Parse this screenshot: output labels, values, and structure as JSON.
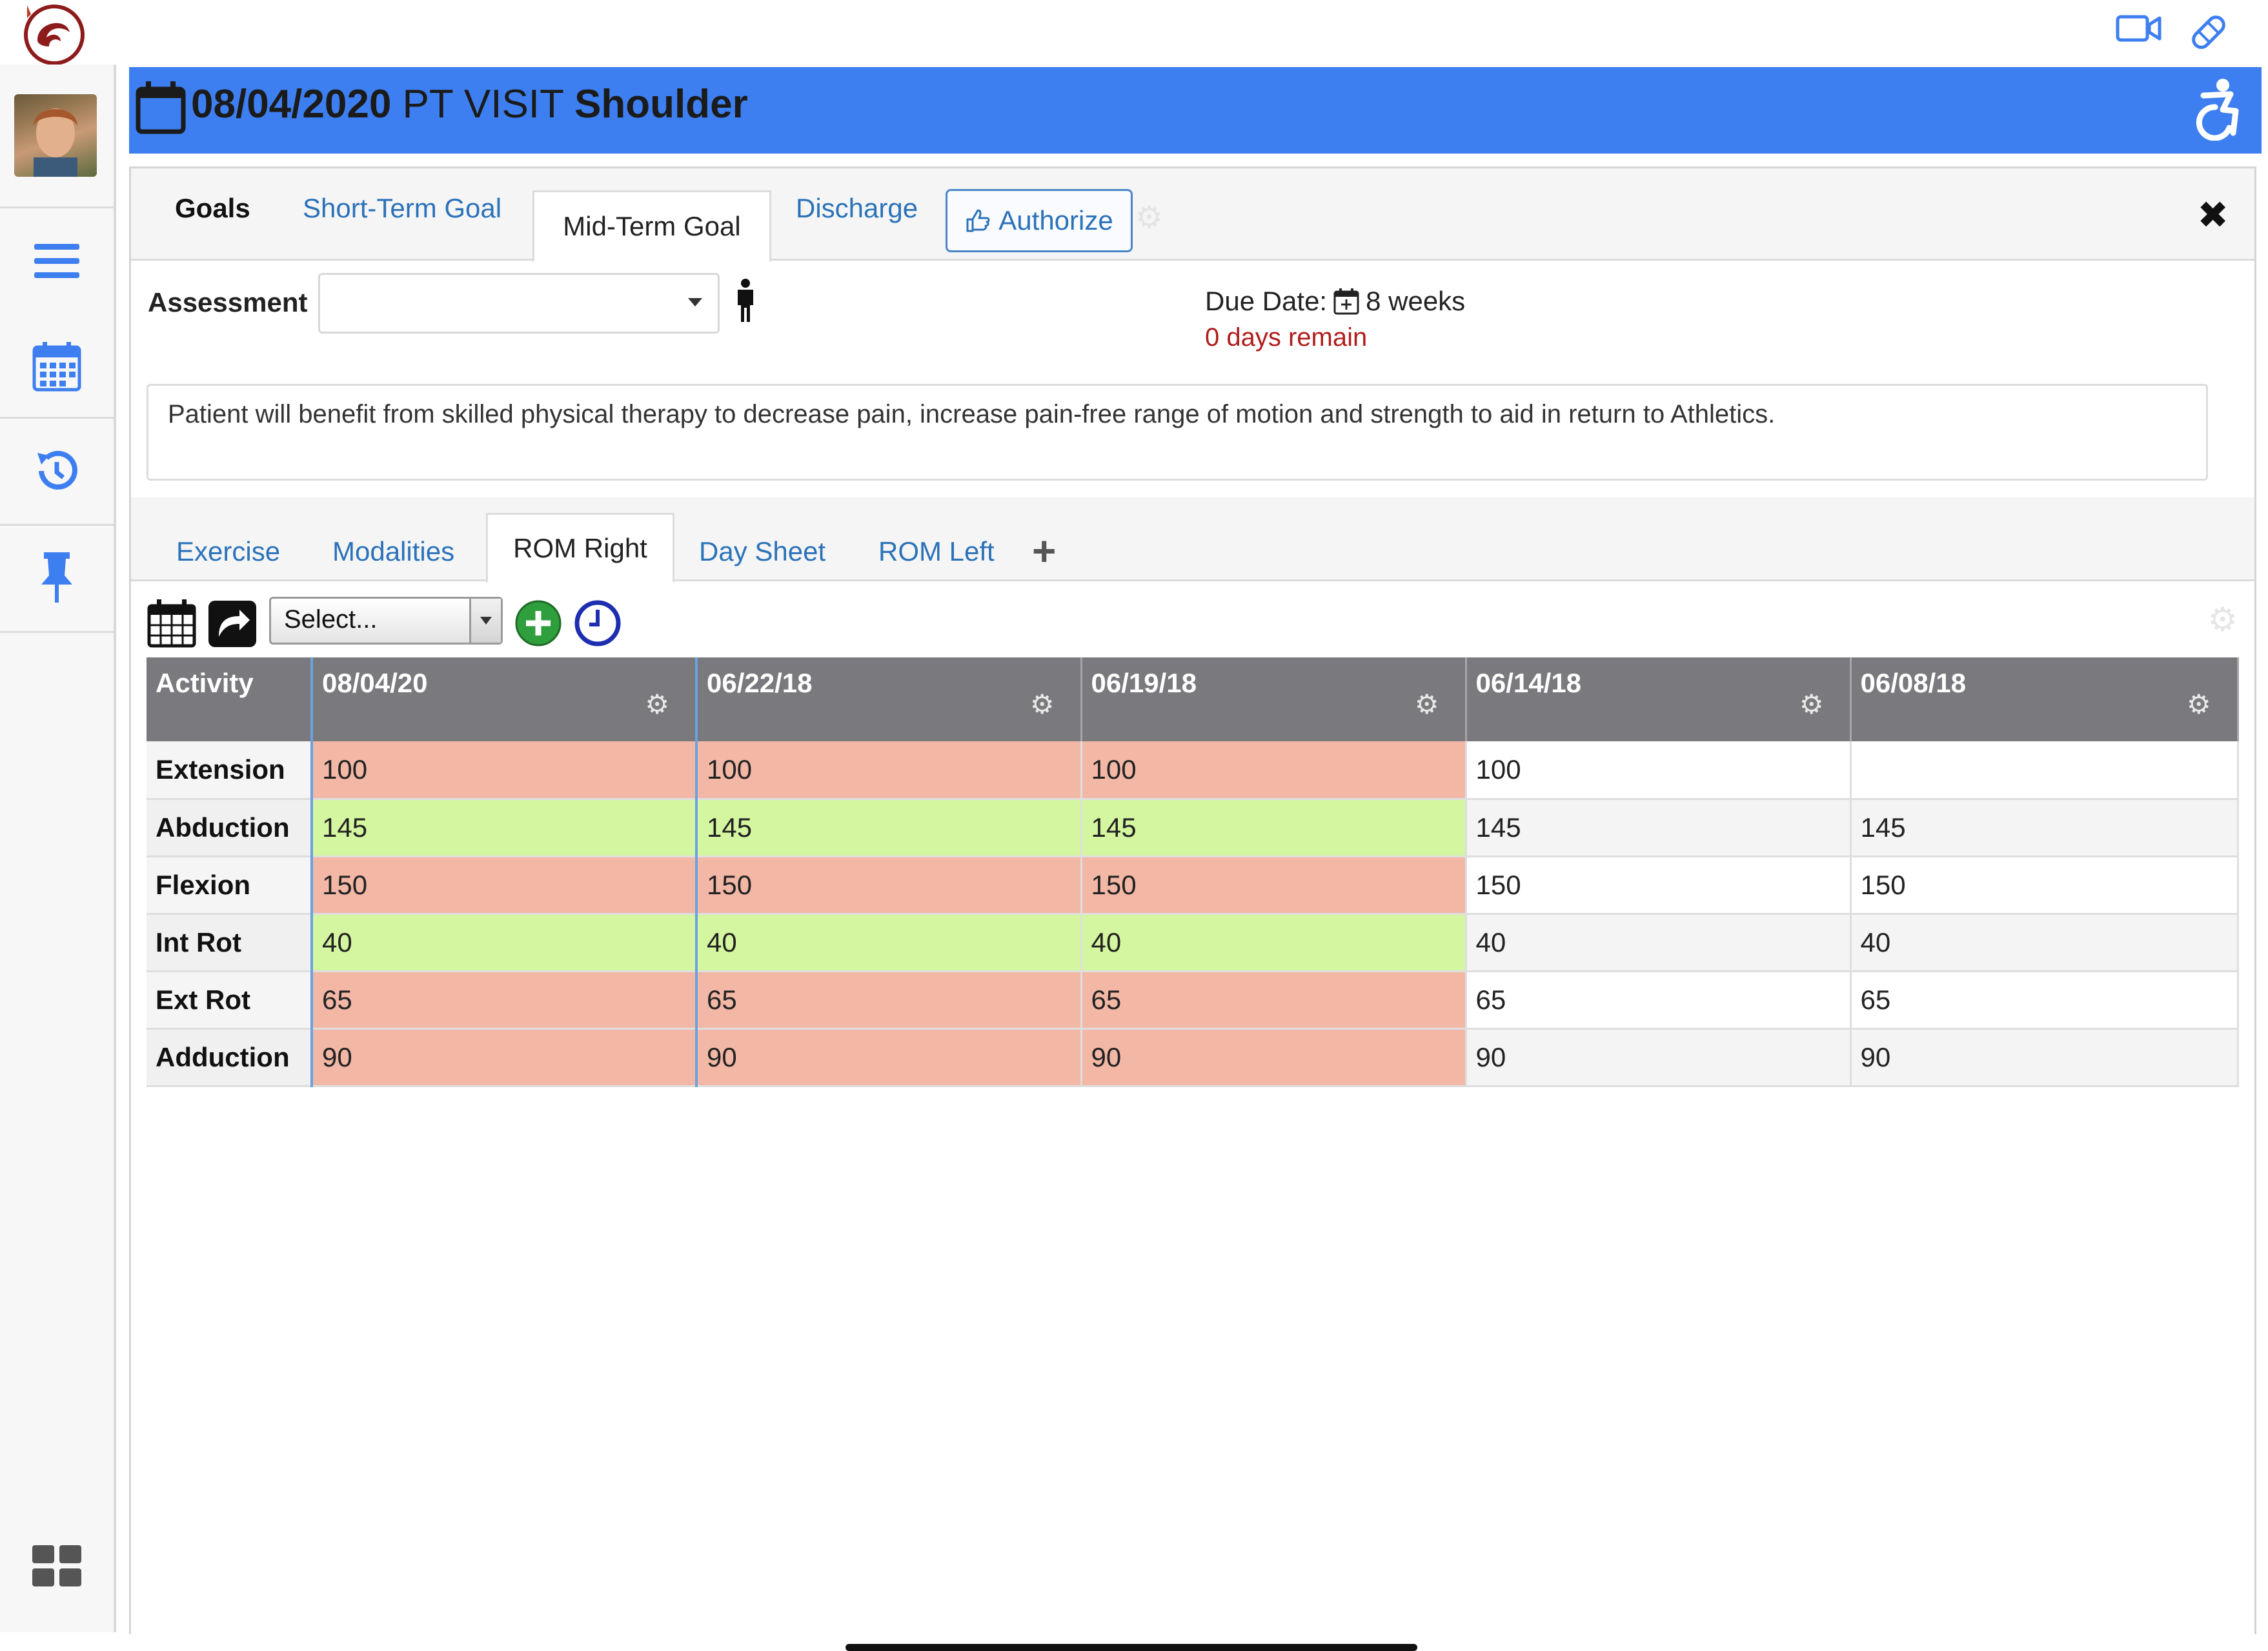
{
  "header": {
    "date": "08/04/2020",
    "visit_type": "PT VISIT",
    "body_part": "Shoulder"
  },
  "goal_tabs": [
    {
      "label": "Goals"
    },
    {
      "label": "Short-Term Goal"
    },
    {
      "label": "Mid-Term Goal"
    },
    {
      "label": "Discharge"
    }
  ],
  "authorize_label": "Authorize",
  "assessment": {
    "label": "Assessment",
    "value": ""
  },
  "due": {
    "label": "Due Date:",
    "value": "8 weeks",
    "remain": "0 days remain"
  },
  "goal_text": "Patient will benefit from skilled physical therapy to decrease pain, increase pain-free range of motion and strength to aid in return to Athletics.",
  "section_tabs": [
    {
      "label": "Exercise"
    },
    {
      "label": "Modalities"
    },
    {
      "label": "ROM Right"
    },
    {
      "label": "Day Sheet"
    },
    {
      "label": "ROM Left"
    }
  ],
  "select_placeholder": "Select...",
  "table": {
    "headers": [
      "Activity",
      "08/04/20",
      "06/22/18",
      "06/19/18",
      "06/14/18",
      "06/08/18"
    ],
    "rows": [
      {
        "activity": "Extension",
        "values": [
          "100",
          "100",
          "100",
          "100",
          ""
        ]
      },
      {
        "activity": "Abduction",
        "values": [
          "145",
          "145",
          "145",
          "145",
          "145"
        ]
      },
      {
        "activity": "Flexion",
        "values": [
          "150",
          "150",
          "150",
          "150",
          "150"
        ]
      },
      {
        "activity": "Int Rot",
        "values": [
          "40",
          "40",
          "40",
          "40",
          "40"
        ]
      },
      {
        "activity": "Ext Rot",
        "values": [
          "65",
          "65",
          "65",
          "65",
          "65"
        ]
      },
      {
        "activity": "Adduction",
        "values": [
          "90",
          "90",
          "90",
          "90",
          "90"
        ]
      }
    ]
  },
  "colors": {
    "header_blue": "#3d7ff0",
    "below_goal": "#f2b7a5",
    "meets_goal": "#d5f6a0",
    "link": "#2b72b9"
  }
}
